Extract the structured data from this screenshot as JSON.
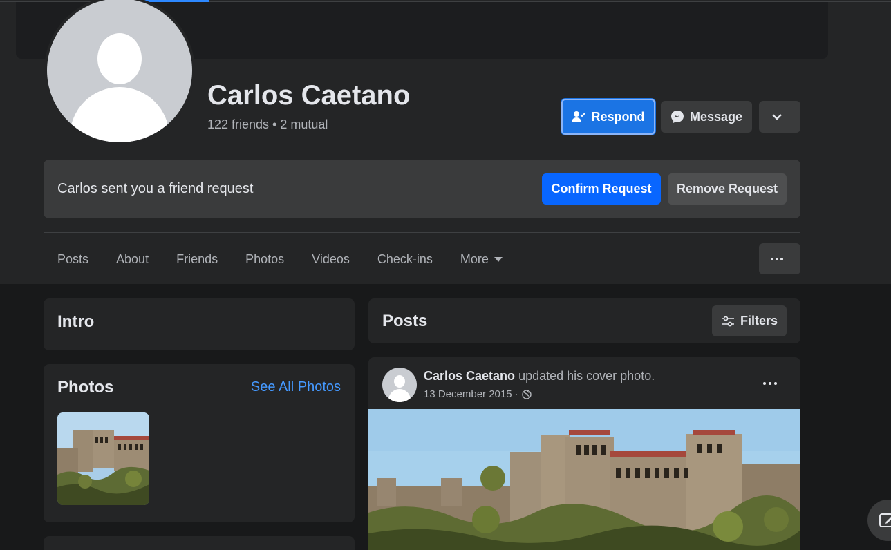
{
  "profile": {
    "name": "Carlos Caetano",
    "friends_summary": "122 friends • 2 mutual"
  },
  "actions": {
    "respond_label": "Respond",
    "message_label": "Message"
  },
  "friend_request": {
    "text": "Carlos sent you a friend request",
    "confirm_label": "Confirm Request",
    "remove_label": "Remove Request"
  },
  "tabs": [
    {
      "label": "Posts"
    },
    {
      "label": "About"
    },
    {
      "label": "Friends"
    },
    {
      "label": "Photos"
    },
    {
      "label": "Videos"
    },
    {
      "label": "Check-ins"
    },
    {
      "label": "More"
    }
  ],
  "intro": {
    "title": "Intro"
  },
  "photos": {
    "title": "Photos",
    "see_all_label": "See All Photos"
  },
  "posts": {
    "title": "Posts",
    "filters_label": "Filters",
    "items": [
      {
        "author": "Carlos Caetano",
        "action": "updated his cover photo.",
        "date": "13 December 2015 ·"
      }
    ]
  },
  "colors": {
    "accent": "#1b74e4",
    "confirm": "#0866ff",
    "link": "#4599ff",
    "surface": "#242526",
    "background": "#18191a"
  }
}
